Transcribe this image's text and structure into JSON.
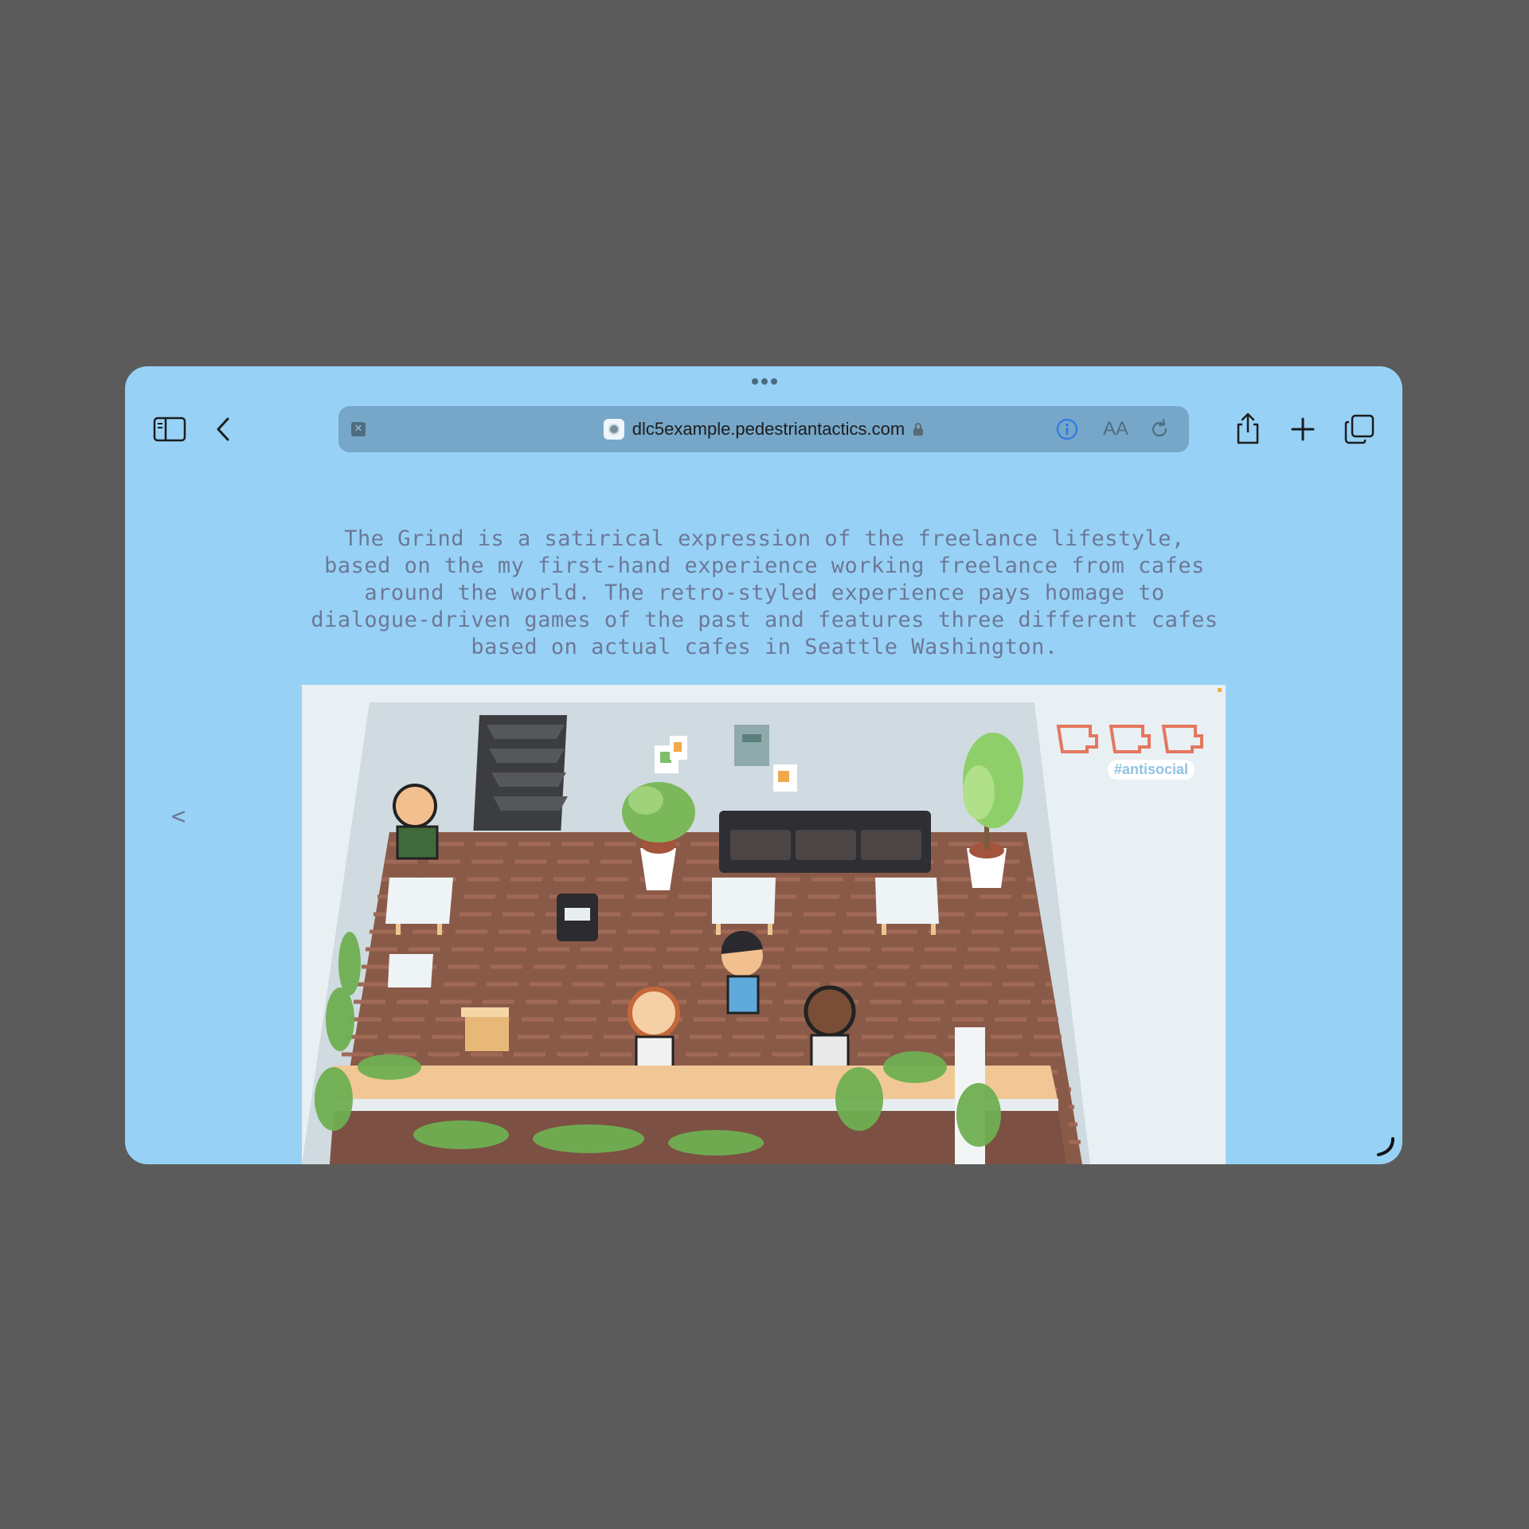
{
  "browser": {
    "url": "dlc5example.pedestriantactics.com",
    "icons": {
      "sidebar": "sidebar-icon",
      "back": "chevron-left-icon",
      "close_tab": "close-icon",
      "favicon": "favicon-icon",
      "lock": "lock-icon",
      "info": "info-icon",
      "text_size": "text-size-icon",
      "text_size_label": "AA",
      "reload": "reload-icon",
      "share": "share-icon",
      "new_tab": "plus-icon",
      "tabs": "tabs-icon"
    }
  },
  "page": {
    "description": "The Grind is a satirical expression of the freelance lifestyle, based on the my first-hand experience working freelance from cafes around the world. The retro-styled experience pays homage to dialogue-driven games of the past and features three different cafes based on actual cafes in Seattle Washington.",
    "prev_arrow": "<",
    "game": {
      "tag": "#antisocial",
      "cups_full": 3,
      "cups_total": 3
    }
  },
  "colors": {
    "background": "#5b5b5b",
    "window": "#97d2f6",
    "url_bar": "#76a7c8",
    "text": "#6d7897",
    "cup": "#e4775f",
    "floor": "#8a5a48"
  }
}
